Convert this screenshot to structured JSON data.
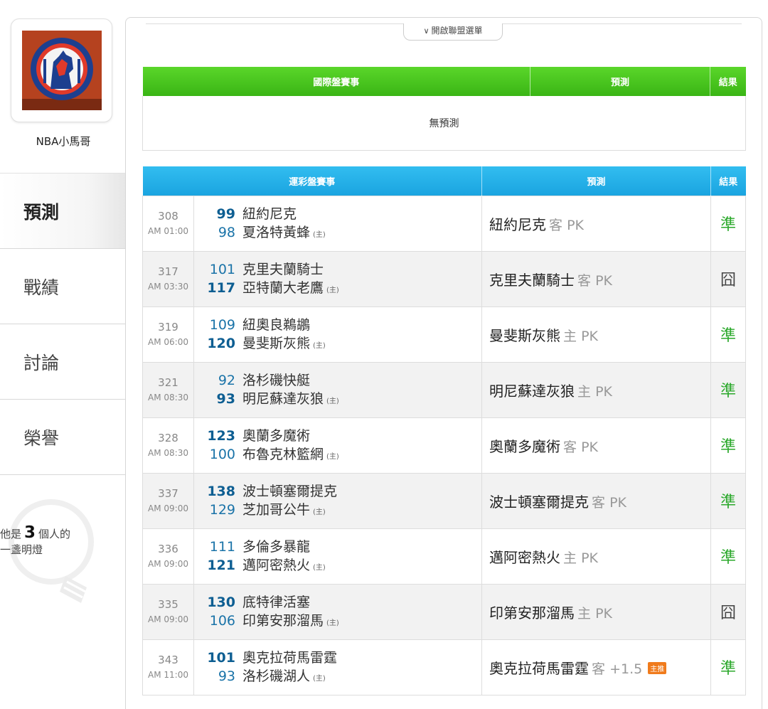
{
  "user": {
    "name": "NBA小馬哥"
  },
  "nav": [
    {
      "label": "預測",
      "active": true
    },
    {
      "label": "戰績",
      "active": false
    },
    {
      "label": "討論",
      "active": false
    },
    {
      "label": "榮譽",
      "active": false
    }
  ],
  "lamp": {
    "prefix": "他是",
    "count": "3",
    "suffix": "個人的",
    "line2": "一盞明燈"
  },
  "league_toggle": {
    "label": "開啟聯盟選單",
    "icon": "chevron-down-icon"
  },
  "intl_table": {
    "headers": [
      "國際盤賽事",
      "預測",
      "結果"
    ],
    "empty_text": "無預測"
  },
  "tw_table": {
    "headers": [
      "運彩盤賽事",
      "預測",
      "結果"
    ],
    "home_tag": "(主)",
    "rows": [
      {
        "id": "308",
        "time": "AM 01:00",
        "away_score": "99",
        "away": "紐約尼克",
        "home_score": "98",
        "home": "夏洛特黃蜂",
        "winner": "away",
        "pick": "紐約尼克",
        "side": "客",
        "line": "PK",
        "badge": "",
        "result": "準",
        "hit": true
      },
      {
        "id": "317",
        "time": "AM 03:30",
        "away_score": "101",
        "away": "克里夫蘭騎士",
        "home_score": "117",
        "home": "亞特蘭大老鷹",
        "winner": "home",
        "pick": "克里夫蘭騎士",
        "side": "客",
        "line": "PK",
        "badge": "",
        "result": "囧",
        "hit": false
      },
      {
        "id": "319",
        "time": "AM 06:00",
        "away_score": "109",
        "away": "紐奧良鵜鶘",
        "home_score": "120",
        "home": "曼斐斯灰熊",
        "winner": "home",
        "pick": "曼斐斯灰熊",
        "side": "主",
        "line": "PK",
        "badge": "",
        "result": "準",
        "hit": true
      },
      {
        "id": "321",
        "time": "AM 08:30",
        "away_score": "92",
        "away": "洛杉磯快艇",
        "home_score": "93",
        "home": "明尼蘇達灰狼",
        "winner": "home",
        "pick": "明尼蘇達灰狼",
        "side": "主",
        "line": "PK",
        "badge": "",
        "result": "準",
        "hit": true
      },
      {
        "id": "328",
        "time": "AM 08:30",
        "away_score": "123",
        "away": "奧蘭多魔術",
        "home_score": "100",
        "home": "布魯克林籃網",
        "winner": "away",
        "pick": "奧蘭多魔術",
        "side": "客",
        "line": "PK",
        "badge": "",
        "result": "準",
        "hit": true
      },
      {
        "id": "337",
        "time": "AM 09:00",
        "away_score": "138",
        "away": "波士頓塞爾提克",
        "home_score": "129",
        "home": "芝加哥公牛",
        "winner": "away",
        "pick": "波士頓塞爾提克",
        "side": "客",
        "line": "PK",
        "badge": "",
        "result": "準",
        "hit": true
      },
      {
        "id": "336",
        "time": "AM 09:00",
        "away_score": "111",
        "away": "多倫多暴龍",
        "home_score": "121",
        "home": "邁阿密熱火",
        "winner": "home",
        "pick": "邁阿密熱火",
        "side": "主",
        "line": "PK",
        "badge": "",
        "result": "準",
        "hit": true
      },
      {
        "id": "335",
        "time": "AM 09:00",
        "away_score": "130",
        "away": "底特律活塞",
        "home_score": "106",
        "home": "印第安那溜馬",
        "winner": "away",
        "pick": "印第安那溜馬",
        "side": "主",
        "line": "PK",
        "badge": "",
        "result": "囧",
        "hit": false
      },
      {
        "id": "343",
        "time": "AM 11:00",
        "away_score": "101",
        "away": "奧克拉荷馬雷霆",
        "home_score": "93",
        "home": "洛杉磯湖人",
        "winner": "away",
        "pick": "奧克拉荷馬雷霆",
        "side": "客",
        "line": "+1.5",
        "badge": "主推",
        "result": "準",
        "hit": true
      }
    ]
  },
  "colors": {
    "intl_header": "#3ab515",
    "tw_header": "#1aa4e0",
    "hit": "#2aa82a",
    "score": "#1a73a8"
  }
}
